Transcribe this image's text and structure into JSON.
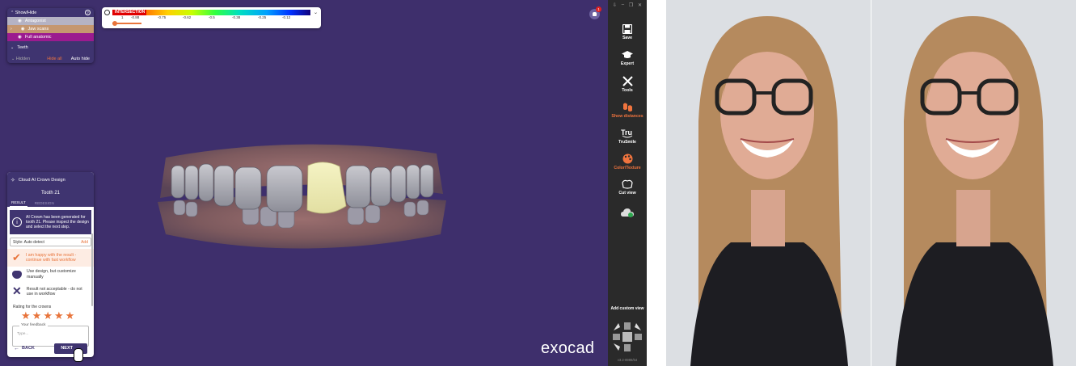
{
  "show_hide_panel": {
    "title": "Show/Hide",
    "rows": [
      {
        "label": "Antagonist",
        "color": "#b5b3c4"
      },
      {
        "label": "Jaw scans",
        "color": "#c59770"
      },
      {
        "label": "Full anatomic",
        "color": "#9b1b8f"
      }
    ],
    "teeth_label": "Teeth",
    "hidden_label": "Hidden",
    "hide_all_label": "Hide all",
    "auto_hide_label": "Auto hide"
  },
  "distance_legend": {
    "title": "INTERSECTION",
    "ticks": [
      "1",
      "-0.88",
      "-0.75",
      "-0.62",
      "-0.5",
      "-0.38",
      "-0.25",
      "-0.12"
    ]
  },
  "notification": {
    "count": "1"
  },
  "crown_panel": {
    "title": "Cloud AI Crown Design",
    "tooth_label": "Tooth 21",
    "tabs": [
      "RESULT",
      "REDESIGN"
    ],
    "info_text": "AI Crown has been generated for tooth 21. Please inspect the design and select the next step.",
    "style_label": "Style: Auto detect",
    "add_label": "Add",
    "options": [
      {
        "text": "I am happy with the result - continue with fast workflow",
        "icon": "check-icon"
      },
      {
        "text": "Use design, but customize manually",
        "icon": "tooth-edit-icon"
      },
      {
        "text": "Result not acceptable - do not use in workflow",
        "icon": "x-icon"
      }
    ],
    "rating_label": "Rating for the crowns",
    "rating": 5,
    "feedback_label": "Your feedback",
    "feedback_placeholder": "Type...",
    "back_label": "BACK",
    "next_label": "NEXT"
  },
  "logo": "exocad",
  "toolbar": {
    "buttons": [
      {
        "label": "Save",
        "icon": "save-icon"
      },
      {
        "label": "Expert",
        "icon": "graduation-cap-icon"
      },
      {
        "label": "Tools",
        "icon": "tools-icon"
      },
      {
        "label": "Show distances",
        "icon": "distances-icon",
        "active": true
      },
      {
        "label": "TruSmile",
        "icon": "trusmile-icon"
      },
      {
        "label": "Color/Texture",
        "icon": "palette-icon",
        "active": true
      },
      {
        "label": "Cut view",
        "icon": "cut-view-icon"
      },
      {
        "label": "",
        "icon": "cloud-icon"
      }
    ],
    "add_custom_view": "Add custom view",
    "version": "v3.2-8986/64"
  },
  "colors": {
    "viewport_bg": "#3e2f6c",
    "accent": "#e8743b",
    "panel_bg": "#3f3470"
  }
}
